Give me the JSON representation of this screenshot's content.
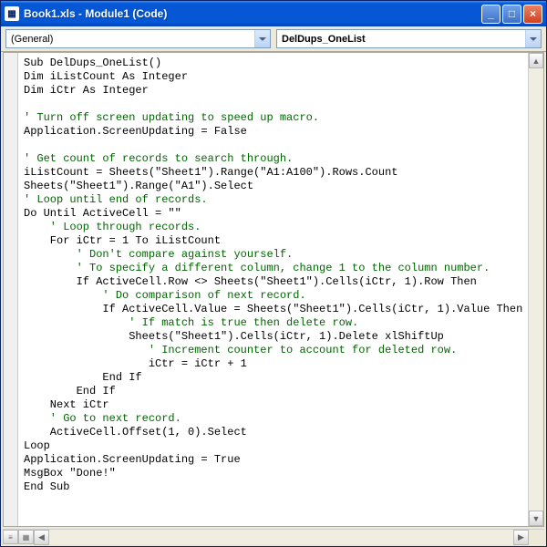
{
  "window": {
    "title": "Book1.xls - Module1 (Code)"
  },
  "dropdowns": {
    "general": "(General)",
    "proc": "DelDups_OneList"
  },
  "code": {
    "l1": "Sub DelDups_OneList()",
    "l2": "Dim iListCount As Integer",
    "l3": "Dim iCtr As Integer",
    "l4": "",
    "l5": "' Turn off screen updating to speed up macro.",
    "l6": "Application.ScreenUpdating = False",
    "l7": "",
    "l8": "' Get count of records to search through.",
    "l9": "iListCount = Sheets(\"Sheet1\").Range(\"A1:A100\").Rows.Count",
    "l10": "Sheets(\"Sheet1\").Range(\"A1\").Select",
    "l11": "' Loop until end of records.",
    "l12": "Do Until ActiveCell = \"\"",
    "l13": "    ' Loop through records.",
    "l14": "    For iCtr = 1 To iListCount",
    "l15": "        ' Don't compare against yourself.",
    "l16": "        ' To specify a different column, change 1 to the column number.",
    "l17": "        If ActiveCell.Row <> Sheets(\"Sheet1\").Cells(iCtr, 1).Row Then",
    "l18": "            ' Do comparison of next record.",
    "l19": "            If ActiveCell.Value = Sheets(\"Sheet1\").Cells(iCtr, 1).Value Then",
    "l20": "                ' If match is true then delete row.",
    "l21": "                Sheets(\"Sheet1\").Cells(iCtr, 1).Delete xlShiftUp",
    "l22": "                   ' Increment counter to account for deleted row.",
    "l23": "                   iCtr = iCtr + 1",
    "l24": "            End If",
    "l25": "        End If",
    "l26": "    Next iCtr",
    "l27": "    ' Go to next record.",
    "l28": "    ActiveCell.Offset(1, 0).Select",
    "l29": "Loop",
    "l30": "Application.ScreenUpdating = True",
    "l31": "MsgBox \"Done!\"",
    "l32": "End Sub"
  }
}
